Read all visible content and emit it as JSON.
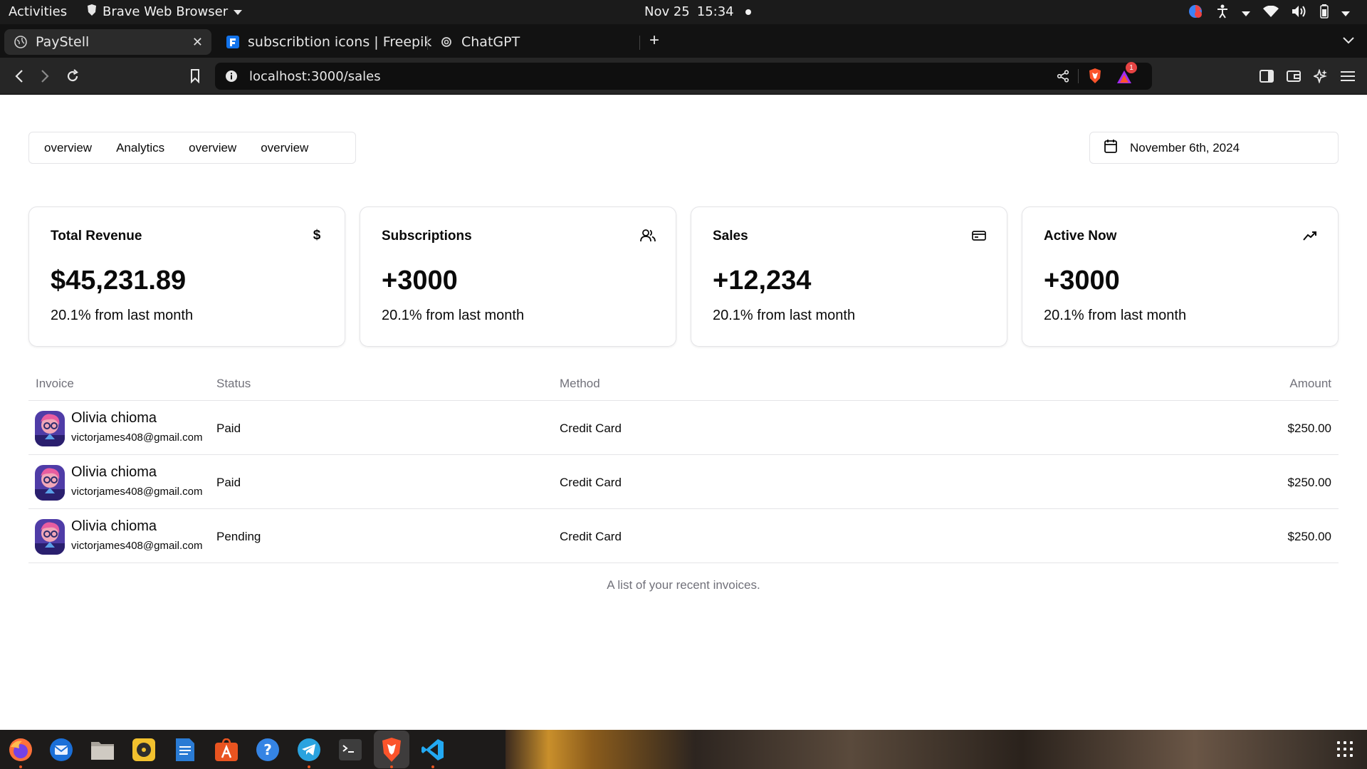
{
  "system": {
    "activities": "Activities",
    "app_name": "Brave Web Browser",
    "date": "Nov 25",
    "time": "15:34"
  },
  "browser": {
    "tabs": [
      {
        "title": "PayStell",
        "active": true
      },
      {
        "title": "subscribtion icons | Freepik",
        "active": false
      },
      {
        "title": "ChatGPT",
        "active": false
      }
    ],
    "url": "localhost:3000/sales",
    "notification_count": "1"
  },
  "page": {
    "tabs": [
      "overview",
      "Analytics",
      "overview",
      "overview"
    ],
    "date": "November 6th, 2024",
    "cards": [
      {
        "title": "Total Revenue",
        "icon": "dollar-icon",
        "icon_text": "$",
        "value": "$45,231.89",
        "sub": "20.1% from last month"
      },
      {
        "title": "Subscriptions",
        "icon": "users-icon",
        "value": "+3000",
        "sub": "20.1% from last month"
      },
      {
        "title": "Sales",
        "icon": "credit-card-icon",
        "value": "+12,234",
        "sub": "20.1% from last month"
      },
      {
        "title": "Active Now",
        "icon": "activity-icon",
        "value": "+3000",
        "sub": "20.1% from last month"
      }
    ],
    "table": {
      "headers": {
        "invoice": "Invoice",
        "status": "Status",
        "method": "Method",
        "amount": "Amount"
      },
      "rows": [
        {
          "name": "Olivia chioma",
          "email": "victorjames408@gmail.com",
          "status": "Paid",
          "method": "Credit Card",
          "amount": "$250.00"
        },
        {
          "name": "Olivia chioma",
          "email": "victorjames408@gmail.com",
          "status": "Paid",
          "method": "Credit Card",
          "amount": "$250.00"
        },
        {
          "name": "Olivia chioma",
          "email": "victorjames408@gmail.com",
          "status": "Pending",
          "method": "Credit Card",
          "amount": "$250.00"
        }
      ],
      "caption": "A list of your recent invoices."
    }
  },
  "dock": {
    "apps": [
      "firefox-icon",
      "thunderbird-icon",
      "files-icon",
      "rhythmbox-icon",
      "writer-icon",
      "app-center-icon",
      "help-icon",
      "telegram-icon",
      "terminal-icon",
      "brave-icon",
      "vscode-icon"
    ]
  }
}
